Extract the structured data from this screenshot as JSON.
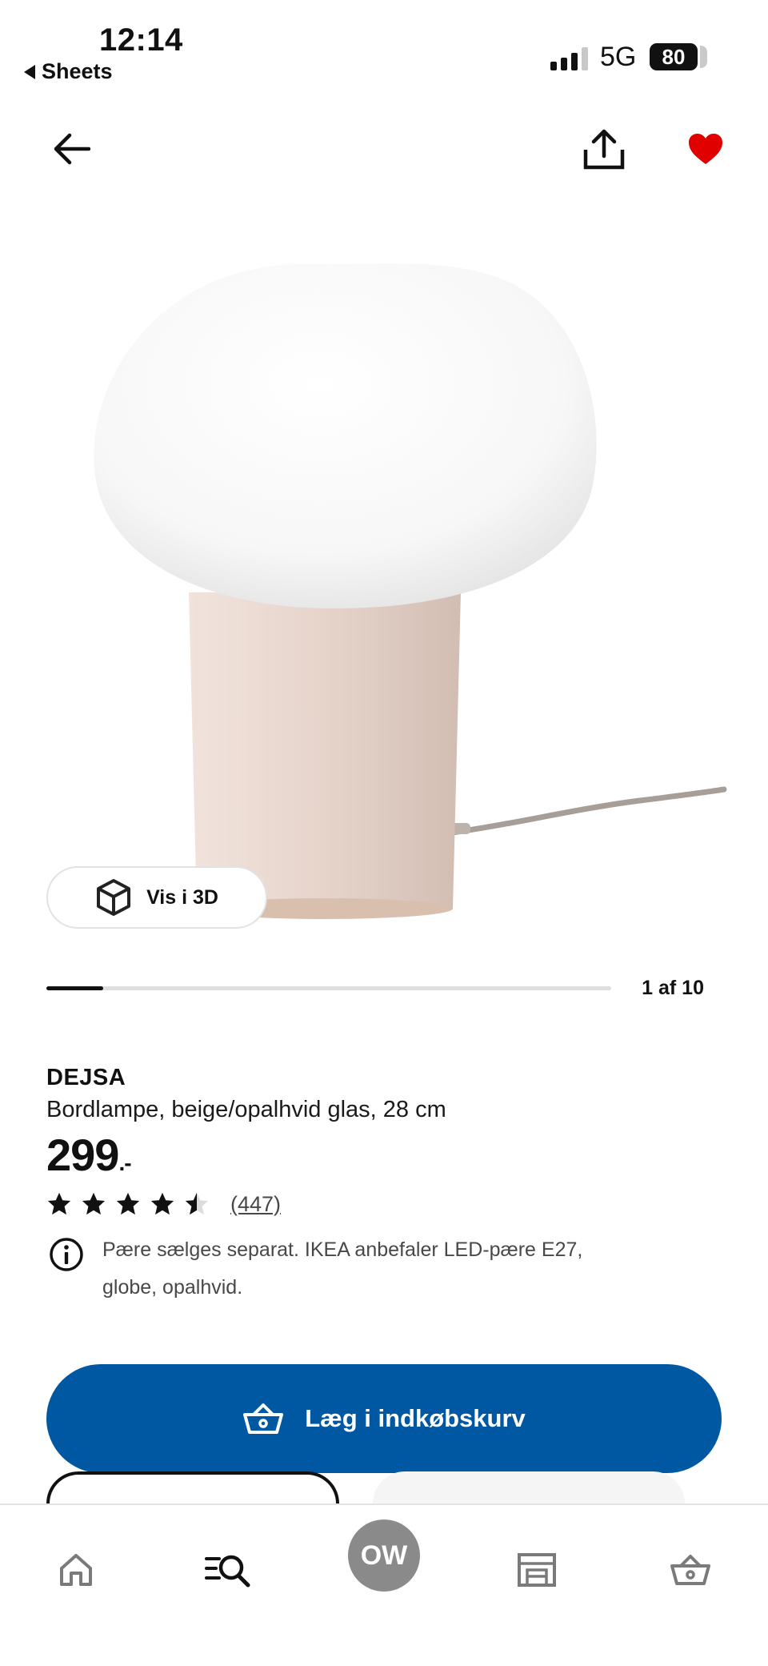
{
  "status_bar": {
    "time": "12:14",
    "back_app": "Sheets",
    "network": "5G",
    "battery": "80"
  },
  "product": {
    "brand": "DEJSA",
    "description": "Bordlampe, beige/opalhvid glas, 28 cm",
    "price_main": "299",
    "price_suffix": ".-",
    "rating": 4.5,
    "rating_max": 5,
    "review_count": "(447)",
    "info_text": "Pære sælges separat. IKEA anbefaler LED-pære E27, globe, opalhvid.",
    "favorited": true
  },
  "gallery": {
    "view_3d_label": "Vis i 3D",
    "counter": "1 af 10",
    "current": 1,
    "total": 10
  },
  "actions": {
    "add_to_cart_label": "Læg i indkøbskurv"
  },
  "tab_bar": {
    "avatar_initials": "OW",
    "items": [
      {
        "name": "home-icon"
      },
      {
        "name": "search-icon"
      },
      {
        "name": "profile"
      },
      {
        "name": "store-icon"
      },
      {
        "name": "basket-icon"
      }
    ]
  },
  "colors": {
    "primary_blue": "#0058a3",
    "favorite_red": "#e00000",
    "text": "#111111",
    "secondary_text": "#484848"
  }
}
